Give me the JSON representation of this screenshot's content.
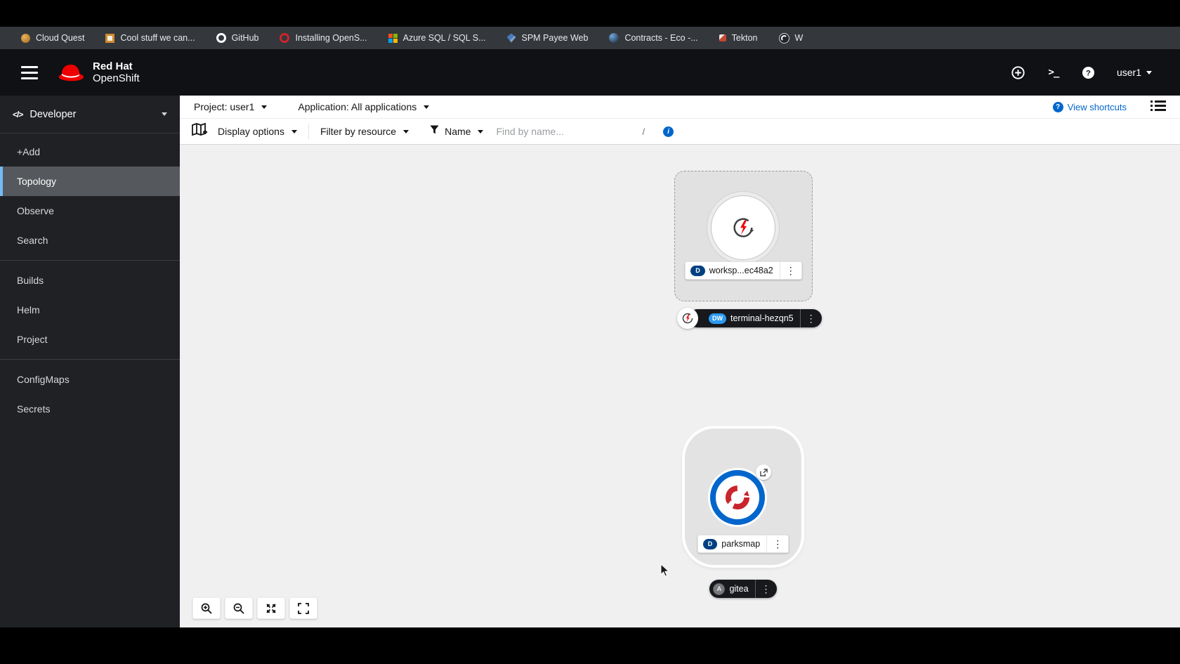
{
  "browser": {
    "bookmarks": [
      {
        "label": "Cloud Quest"
      },
      {
        "label": "Cool stuff we can..."
      },
      {
        "label": "GitHub"
      },
      {
        "label": "Installing OpenS..."
      },
      {
        "label": "Azure SQL / SQL S..."
      },
      {
        "label": "SPM Payee Web"
      },
      {
        "label": "Contracts - Eco -..."
      },
      {
        "label": "Tekton"
      },
      {
        "label": "W"
      }
    ]
  },
  "masthead": {
    "brand_line1": "Red Hat",
    "brand_line2": "OpenShift",
    "user": "user1"
  },
  "sidebar": {
    "perspective": "Developer",
    "items": [
      {
        "label": "+Add"
      },
      {
        "label": "Topology"
      },
      {
        "label": "Observe"
      },
      {
        "label": "Search"
      },
      {
        "label": "Builds"
      },
      {
        "label": "Helm"
      },
      {
        "label": "Project"
      },
      {
        "label": "ConfigMaps"
      },
      {
        "label": "Secrets"
      }
    ],
    "active": "Topology"
  },
  "context_bar": {
    "project": "Project: user1",
    "application": "Application: All applications",
    "view_shortcuts": "View shortcuts"
  },
  "toolbar": {
    "display_options": "Display options",
    "filter_by_resource": "Filter by resource",
    "name_filter": "Name",
    "find_placeholder": "Find by name...",
    "shortcut_hint": "/"
  },
  "topology": {
    "workspace": {
      "badge": "D",
      "label": "worksp...ec48a2"
    },
    "terminal": {
      "badge": "DW",
      "label": "terminal-hezqn5"
    },
    "parksmap": {
      "badge": "D",
      "label": "parksmap"
    },
    "gitea": {
      "badge": "A",
      "label": "gitea"
    }
  },
  "colors": {
    "accent_blue": "#0066cc",
    "badge_deployment": "#004080",
    "badge_devworkspace": "#2b9af3",
    "openshift_red": "#ee0000",
    "sidebar_active_indicator": "#73bcf7"
  }
}
